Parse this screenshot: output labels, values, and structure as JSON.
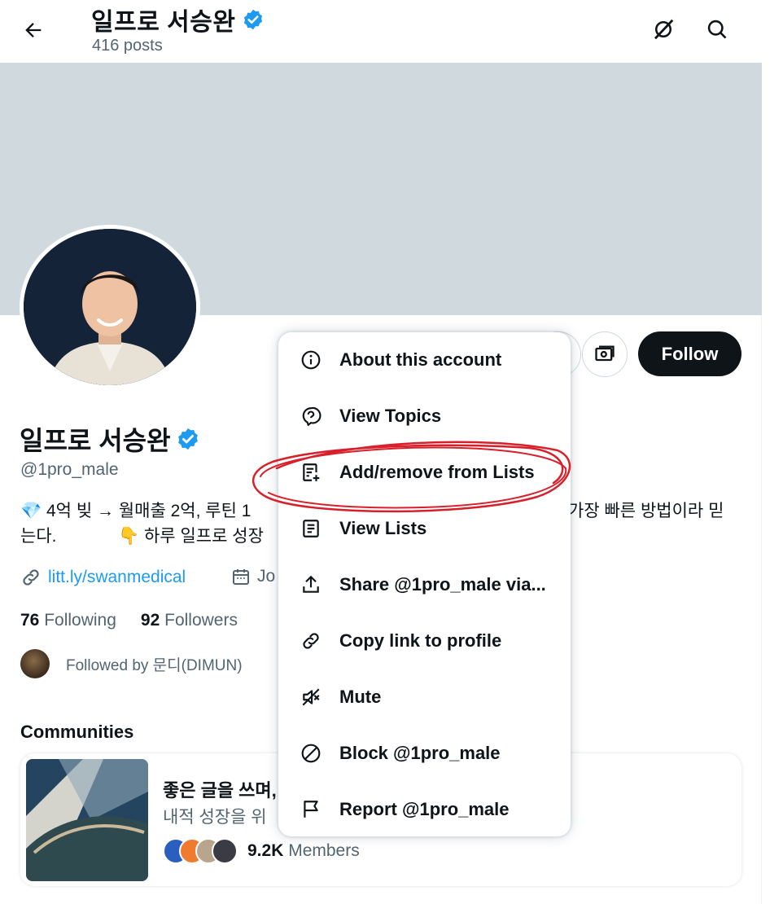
{
  "header": {
    "name": "일프로 서승완",
    "posts": "416 posts"
  },
  "profile": {
    "name": "일프로 서승완",
    "handle": "@1pro_male",
    "bio_line1_start": "💎 4억 빚 → 월매출 2억, 루틴 1",
    "bio_line1_end": "가장 빠른 방법이라 믿",
    "bio_line2_start": "는다.",
    "bio_line2_end": "👇 하루 일프로 성장",
    "link": "litt.ly/swanmedical",
    "joined_partial": "Jo",
    "following_count": "76",
    "following_label": "Following",
    "followers_count": "92",
    "followers_label": "Followers",
    "followed_by": "Followed by 문디(DIMUN)",
    "follow_button": "Follow"
  },
  "communities": {
    "title": "Communities",
    "card": {
      "name_partial": "좋은 글을 쓰며,",
      "sub_partial": "내적 성장을 위",
      "members_count": "9.2K",
      "members_label": "Members"
    }
  },
  "menu": {
    "items": [
      {
        "label": "About this account",
        "icon": "info-icon"
      },
      {
        "label": "View Topics",
        "icon": "topic-icon"
      },
      {
        "label": "Add/remove from Lists",
        "icon": "list-add-icon"
      },
      {
        "label": "View Lists",
        "icon": "list-icon"
      },
      {
        "label": "Share @1pro_male via...",
        "icon": "share-icon"
      },
      {
        "label": "Copy link to profile",
        "icon": "link-icon"
      },
      {
        "label": "Mute",
        "icon": "mute-icon"
      },
      {
        "label": "Block @1pro_male",
        "icon": "block-icon"
      },
      {
        "label": "Report @1pro_male",
        "icon": "flag-icon"
      }
    ]
  },
  "colors": {
    "accent": "#1d9bf0",
    "banner": "#cfd9de",
    "scribble": "#d8202a"
  }
}
